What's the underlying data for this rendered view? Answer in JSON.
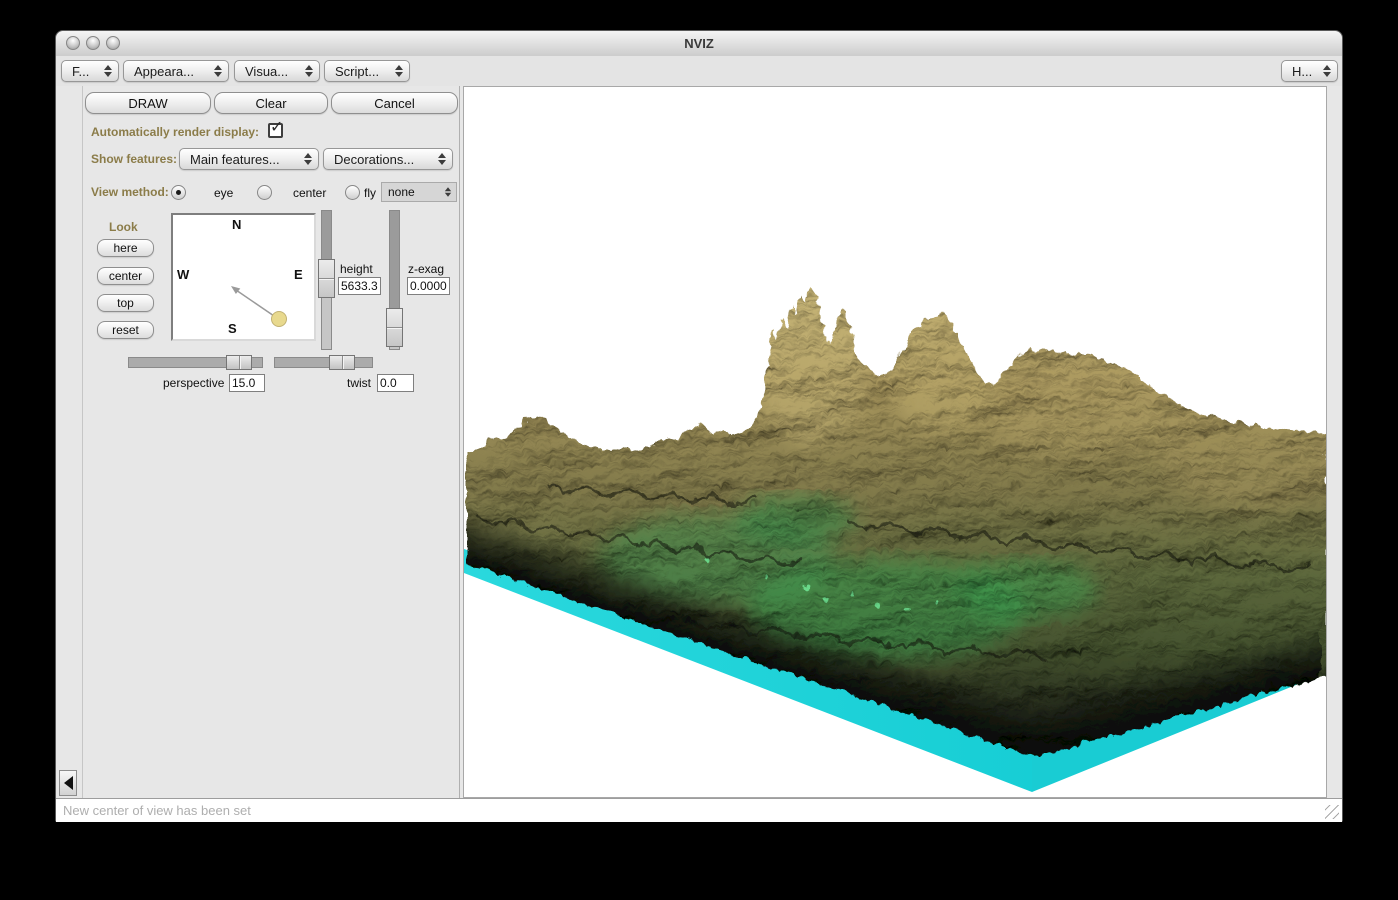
{
  "window": {
    "title": "NVIZ"
  },
  "menubar": {
    "items": [
      {
        "label": "F..."
      },
      {
        "label": "Appeara..."
      },
      {
        "label": "Visua..."
      },
      {
        "label": "Script..."
      }
    ],
    "help_label": "H..."
  },
  "toolbar": {
    "draw_label": "DRAW",
    "clear_label": "Clear",
    "cancel_label": "Cancel"
  },
  "panel": {
    "auto_render_label": "Automatically render display:",
    "auto_render_checked": true,
    "show_features_label": "Show features:",
    "main_features_dropdown": "Main features...",
    "decorations_dropdown": "Decorations...",
    "view_method_label": "View method:",
    "view_methods": [
      "eye",
      "center",
      "fly"
    ],
    "selected_view_method": "eye",
    "fly_mode_dropdown": "none",
    "look": {
      "label": "Look",
      "buttons": [
        "here",
        "center",
        "top",
        "reset"
      ]
    },
    "compass": {
      "north": "N",
      "south": "S",
      "east": "E",
      "west": "W"
    },
    "height": {
      "label": "height",
      "value": "5633.3"
    },
    "zexag": {
      "label": "z-exag",
      "value": "0.0000"
    },
    "perspective": {
      "label": "perspective",
      "value": "15.0"
    },
    "twist": {
      "label": "twist",
      "value": "0.0"
    }
  },
  "viewport": {
    "description": "3D rendered terrain surface with tall eroded peaks on a cyan base slab",
    "colors": {
      "background": "#ffffff",
      "base_slab_cyan": "#1fd2d8",
      "terrain_tan_peaks": "#a6945c",
      "terrain_green_valley": "#4e7a42",
      "terrain_dark_shadow": "#14160e"
    }
  },
  "statusbar": {
    "message": "New center of view has been set"
  }
}
